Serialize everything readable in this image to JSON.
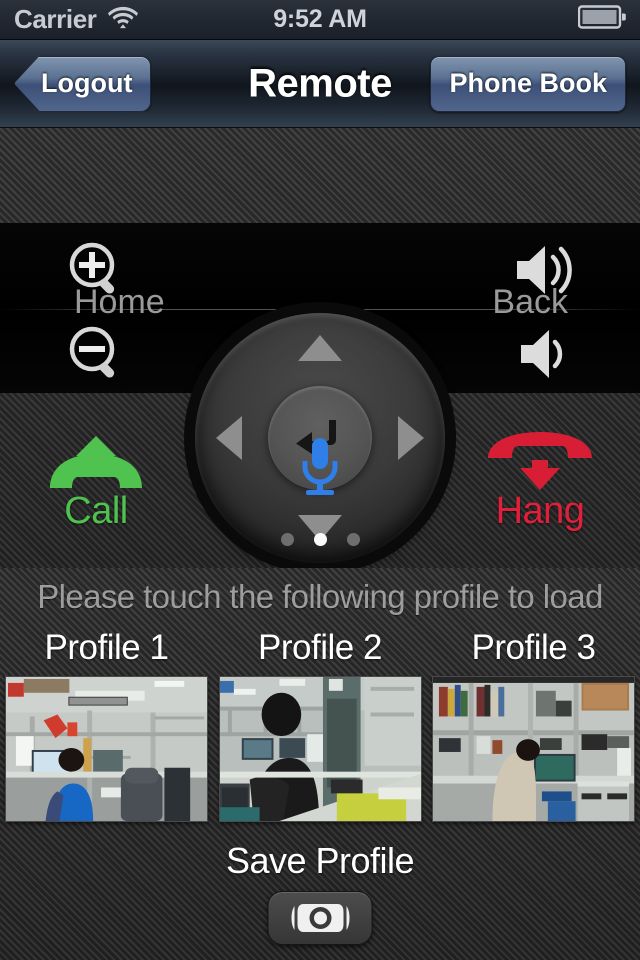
{
  "statusbar": {
    "carrier": "Carrier",
    "time": "9:52 AM",
    "wifi_icon": "wifi-icon",
    "battery_icon": "battery-icon"
  },
  "navbar": {
    "title": "Remote",
    "left_button": "Logout",
    "right_button": "Phone Book"
  },
  "remote": {
    "home_label": "Home",
    "back_label": "Back",
    "zoom_in_icon": "zoom-in-icon",
    "zoom_out_icon": "zoom-out-icon",
    "volume_up_icon": "volume-up-icon",
    "volume_down_icon": "volume-down-icon",
    "dpad": {
      "up_icon": "arrow-up-icon",
      "down_icon": "arrow-down-icon",
      "left_icon": "arrow-left-icon",
      "right_icon": "arrow-right-icon",
      "center_icon": "enter-return-icon"
    },
    "call_label": "Call",
    "call_icon": "phone-call-up-icon",
    "hang_label": "Hang",
    "hang_icon": "phone-hang-down-icon",
    "mic_icon": "microphone-icon",
    "page_dots": {
      "count": 3,
      "active_index": 1
    }
  },
  "profiles": {
    "hint": "Please touch the following profile to load",
    "items": [
      {
        "name": "Profile 1",
        "thumb_alt": "office-cubicle-person-blue-vest"
      },
      {
        "name": "Profile 2",
        "thumb_alt": "office-chair-door-desk"
      },
      {
        "name": "Profile 3",
        "thumb_alt": "office-shelves-person-computer"
      }
    ],
    "save_label": "Save Profile",
    "save_icon": "camera-icon"
  },
  "colors": {
    "call_green": "#4fc24f",
    "hang_red": "#e0203a",
    "mic_blue": "#2f7fe8",
    "nav_blue": "#5c7293",
    "active_dot": "#fafafa"
  }
}
